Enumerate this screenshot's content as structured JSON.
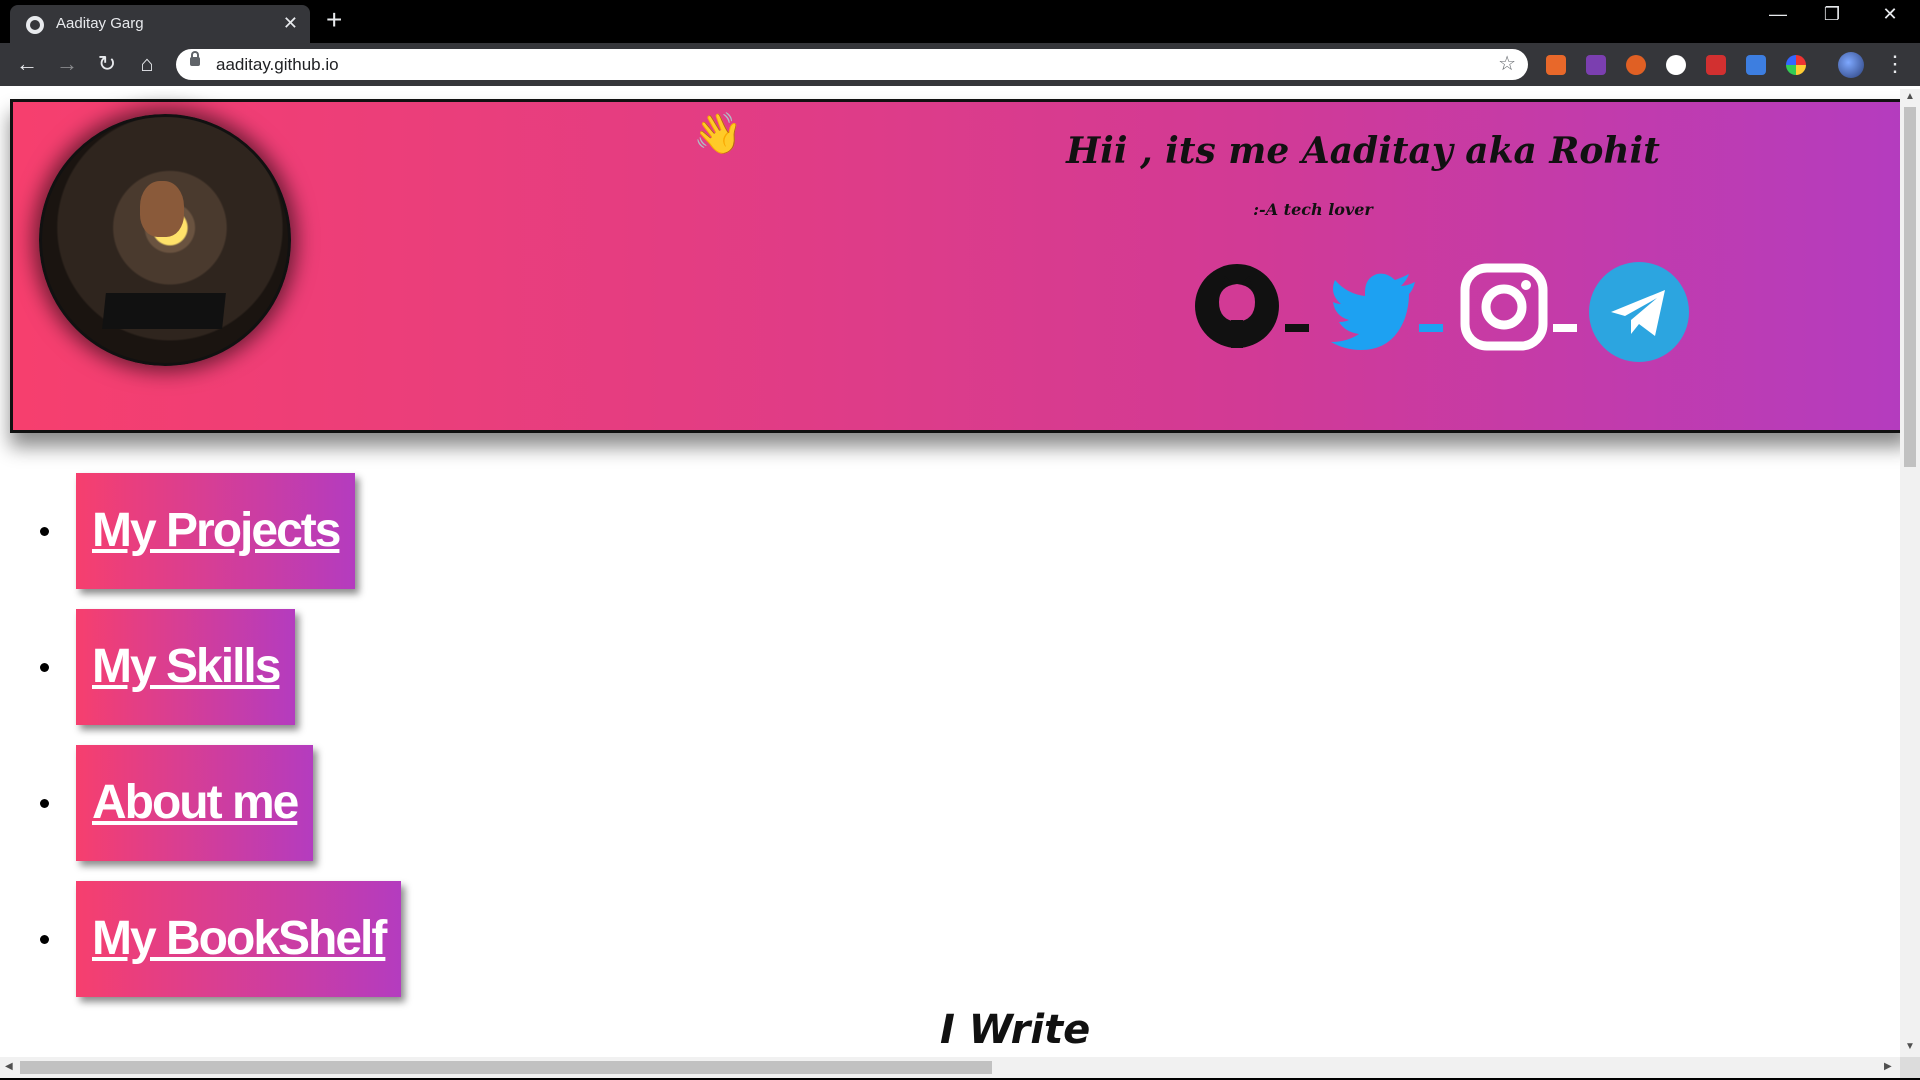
{
  "browser": {
    "tab_title": "Aaditay Garg",
    "url": "aaditay.github.io",
    "new_tab_symbol": "+",
    "close_symbol": "✕",
    "window_controls": {
      "minimize": "—",
      "restore": "❐",
      "close": "✕"
    },
    "nav": {
      "back": "←",
      "forward": "→",
      "reload": "↻",
      "home": "⌂"
    },
    "star": "☆",
    "menu": "⋮"
  },
  "header": {
    "wave_emoji": "👋",
    "greeting": "Hii , its me Aaditay aka Rohit",
    "tagline": ":-A tech lover",
    "social": [
      {
        "name": "github",
        "color": "#111111"
      },
      {
        "name": "twitter",
        "color": "#1da1f2"
      },
      {
        "name": "instagram",
        "color": "#ffffff"
      },
      {
        "name": "telegram",
        "color": "#2ca5e0"
      }
    ]
  },
  "nav": {
    "items": [
      {
        "label": "My Projects"
      },
      {
        "label": "My Skills"
      },
      {
        "label": "About me"
      },
      {
        "label": "My BookShelf"
      }
    ]
  },
  "section": {
    "heading": "I Write"
  },
  "colors": {
    "gradient_start": "#f63f6e",
    "gradient_end": "#b43cbf",
    "chrome_dark": "#35363a"
  }
}
